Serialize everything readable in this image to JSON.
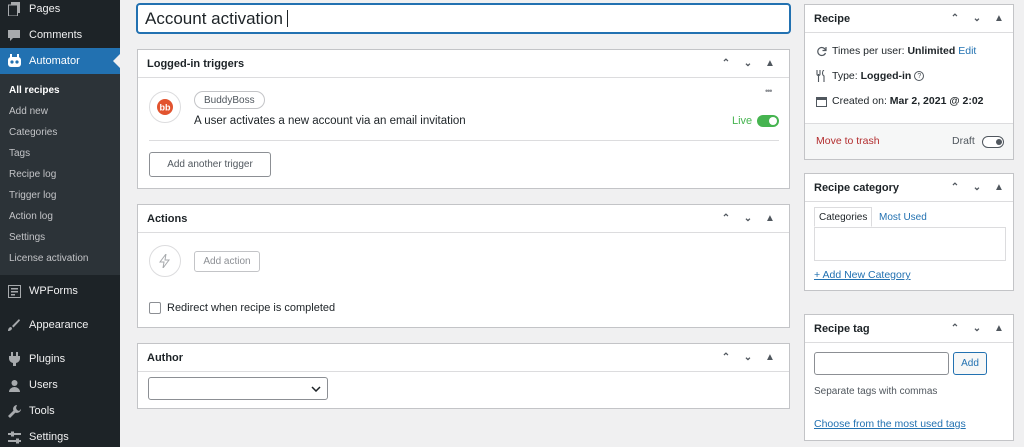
{
  "sidebar": {
    "top_items": [
      {
        "label": "Pages",
        "icon": "pages-icon"
      },
      {
        "label": "Comments",
        "icon": "comments-icon"
      }
    ],
    "active": {
      "label": "Automator",
      "icon": "automator-icon"
    },
    "submenu": [
      "All recipes",
      "Add new",
      "Categories",
      "Tags",
      "Recipe log",
      "Trigger log",
      "Action log",
      "Settings",
      "License activation"
    ],
    "bottom_items": [
      {
        "label": "WPForms",
        "icon": "wpforms-icon"
      },
      {
        "label": "Appearance",
        "icon": "appearance-icon"
      },
      {
        "label": "Plugins",
        "icon": "plugins-icon"
      },
      {
        "label": "Users",
        "icon": "users-icon"
      },
      {
        "label": "Tools",
        "icon": "tools-icon"
      },
      {
        "label": "Settings",
        "icon": "settings-icon"
      }
    ]
  },
  "title": {
    "value": "Account activation"
  },
  "triggers": {
    "header": "Logged-in triggers",
    "integration": "BuddyBoss",
    "trigger_text": "A user activates a new account via an email invitation",
    "status": "Live",
    "more": "•••",
    "add_button": "Add another trigger",
    "brand_color": "#e2542f"
  },
  "actions": {
    "header": "Actions",
    "add_button": "Add action",
    "redirect_label": "Redirect when recipe is completed"
  },
  "author": {
    "header": "Author",
    "selected": ""
  },
  "recipe_box": {
    "header": "Recipe",
    "times_label": "Times per user:",
    "times_value": "Unlimited",
    "times_edit": "Edit",
    "type_label": "Type:",
    "type_value": "Logged-in",
    "help": "?",
    "created_label": "Created on:",
    "created_value": "Mar 2, 2021 @ 2:02",
    "trash": "Move to trash",
    "draft": "Draft"
  },
  "category_box": {
    "header": "Recipe category",
    "tab_categories": "Categories",
    "tab_most_used": "Most Used",
    "add_new": "+ Add New Category"
  },
  "tag_box": {
    "header": "Recipe tag",
    "add_button": "Add",
    "hint": "Separate tags with commas",
    "choose": "Choose from the most used tags"
  },
  "controls": {
    "up": "⌃",
    "down": "⌄",
    "toggle": "▲"
  }
}
